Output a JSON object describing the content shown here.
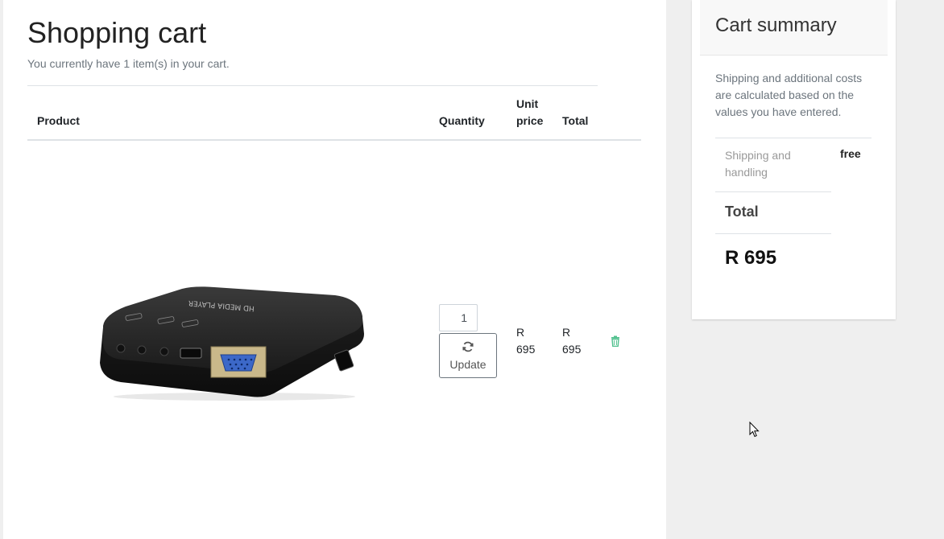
{
  "cart": {
    "title": "Shopping cart",
    "subtitle": "You currently have 1 item(s) in your cart.",
    "columns": {
      "product": "Product",
      "quantity": "Quantity",
      "unit_price_line1": "Unit",
      "unit_price_line2": "price",
      "total": "Total"
    },
    "items": [
      {
        "quantity": "1",
        "update_label": "Update",
        "unit_price_currency": "R",
        "unit_price_amount": "695",
        "total_currency": "R",
        "total_amount": "695"
      }
    ]
  },
  "summary": {
    "title": "Cart summary",
    "note": "Shipping and additional costs are calculated based on the values you have entered.",
    "shipping_label": "Shipping and handling",
    "shipping_value": "free",
    "total_label": "Total",
    "total_value": "R 695"
  },
  "colors": {
    "accent": "#4fc08d",
    "page_bg": "#efefef",
    "card_header_bg": "#f8f8f8"
  },
  "icons": {
    "update": "refresh-icon",
    "remove": "trash-icon"
  }
}
